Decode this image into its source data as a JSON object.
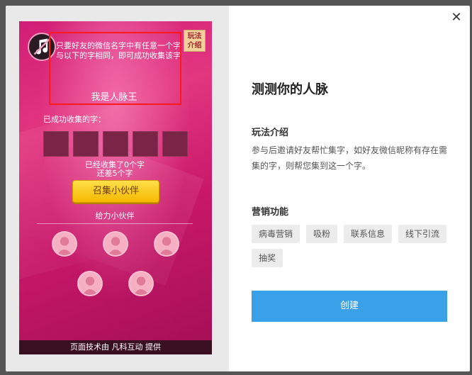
{
  "phone": {
    "rules_badge": "玩法介绍",
    "intro_line1": "只要好友的微信名字中有任意一个字",
    "intro_line2": "与以下的字相同，即可成功收集该字",
    "king": "我是人脉王",
    "collected_label": "已成功收集的字：",
    "status_line1": "已经收集了0个字",
    "status_line2": "还差5个字",
    "gather_button": "召集小伙伴",
    "helper_label": "给力小伙伴",
    "footer": "页面技术由 凡科互动 提供"
  },
  "panel": {
    "title": "测测你的人脉",
    "intro_heading": "玩法介绍",
    "intro_body": "参与后邀请好友帮忙集字，如好友微信昵称有存在需集的字，则帮您集到这一个字。",
    "marketing_heading": "营销功能",
    "tags": [
      "病毒营销",
      "吸粉",
      "联系信息",
      "线下引流",
      "抽奖"
    ],
    "create_button": "创建"
  },
  "icons": {
    "close": "close-icon",
    "music": "music-icon",
    "avatar": "avatar-icon"
  },
  "colors": {
    "accent": "#3aa0e8",
    "phone_bg": "#d21d76",
    "gather_btn": "#f5b800",
    "highlight_box": "#ff1a1a"
  }
}
